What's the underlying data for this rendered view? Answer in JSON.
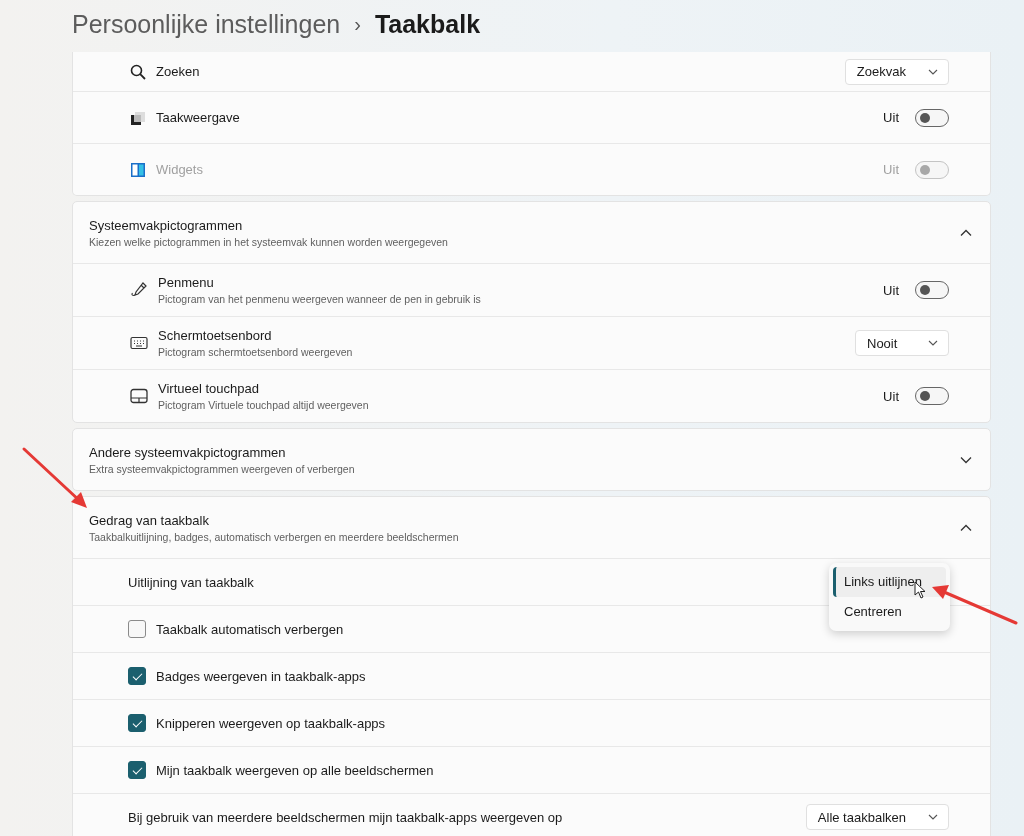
{
  "breadcrumb": {
    "parent": "Persoonlijke instellingen",
    "separator": "›",
    "current": "Taakbalk"
  },
  "sections": [
    {
      "kind": "list",
      "rows": [
        {
          "kind": "dropdown",
          "label": "Zoeken",
          "value": "Zoekvak"
        },
        {
          "kind": "toggle",
          "label": "Taakweergave",
          "state_text": "Uit",
          "on": false,
          "disabled": false
        },
        {
          "kind": "toggle",
          "label": "Widgets",
          "state_text": "Uit",
          "on": false,
          "disabled": true
        }
      ]
    },
    {
      "kind": "group",
      "title": "Systeemvakpictogrammen",
      "subtitle": "Kiezen welke pictogrammen in het systeemvak kunnen worden weergegeven",
      "expanded": true,
      "rows": [
        {
          "kind": "toggle",
          "label": "Penmenu",
          "description": "Pictogram van het penmenu weergeven wanneer de pen in gebruik is",
          "state_text": "Uit",
          "on": false,
          "disabled": false
        },
        {
          "kind": "dropdown",
          "label": "Schermtoetsenbord",
          "description": "Pictogram schermtoetsenbord weergeven",
          "value": "Nooit"
        },
        {
          "kind": "toggle",
          "label": "Virtueel touchpad",
          "description": "Pictogram Virtuele touchpad altijd weergeven",
          "state_text": "Uit",
          "on": false,
          "disabled": false
        }
      ]
    },
    {
      "kind": "group",
      "title": "Andere systeemvakpictogrammen",
      "subtitle": "Extra systeemvakpictogrammen weergeven of verbergen",
      "expanded": false
    },
    {
      "kind": "group",
      "title": "Gedrag van taakbalk",
      "subtitle": "Taakbalkuitlijning, badges, automatisch verbergen en meerdere beeldschermen",
      "expanded": true,
      "rows": [
        {
          "kind": "menu",
          "label": "Uitlijning van taakbalk",
          "options": [
            {
              "label": "Links uitlijnen",
              "selected": true
            },
            {
              "label": "Centreren",
              "selected": false
            }
          ]
        },
        {
          "kind": "checkbox",
          "label": "Taakbalk automatisch verbergen",
          "checked": false
        },
        {
          "kind": "checkbox",
          "label": "Badges weergeven in taakbalk-apps",
          "checked": true
        },
        {
          "kind": "checkbox",
          "label": "Knipperen weergeven op taakbalk-apps",
          "checked": true
        },
        {
          "kind": "checkbox",
          "label": "Mijn taakbalk weergeven op alle beeldschermen",
          "checked": true
        },
        {
          "kind": "dropdown",
          "label": "Bij gebruik van meerdere beeldschermen mijn taakbalk-apps weergeven op",
          "value": "Alle taakbalken"
        }
      ]
    }
  ]
}
